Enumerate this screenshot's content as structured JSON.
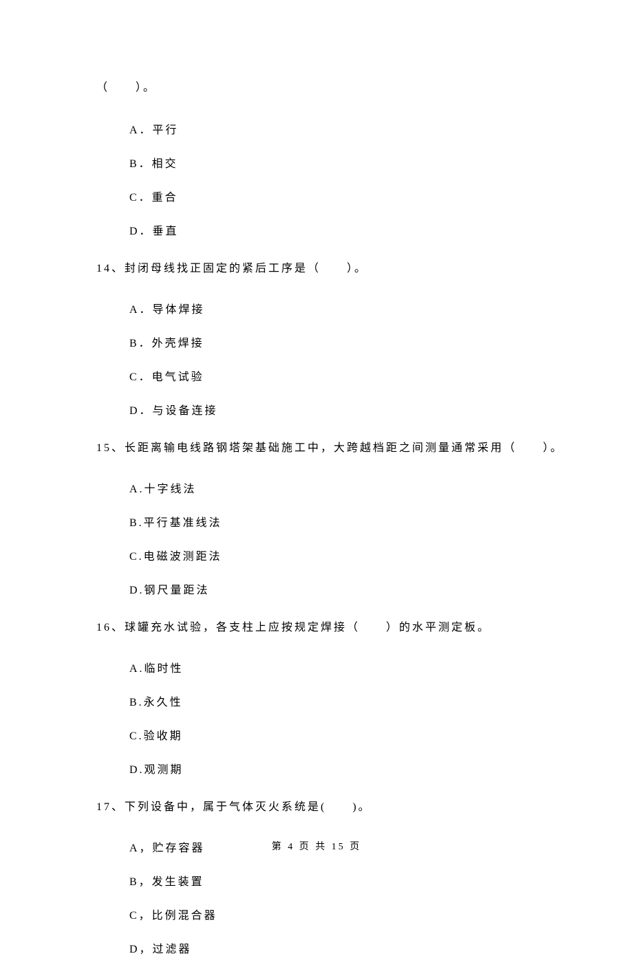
{
  "fragment": "（　　）。",
  "q13_options": {
    "a": "A．平行",
    "b": "B．相交",
    "c": "C．重合",
    "d": "D．垂直"
  },
  "q14": {
    "text": "14、封闭母线找正固定的紧后工序是（　　）。",
    "a": "A．导体焊接",
    "b": "B．外壳焊接",
    "c": "C．电气试验",
    "d": "D．与设备连接"
  },
  "q15": {
    "text": "15、长距离输电线路钢塔架基础施工中，大跨越档距之间测量通常采用（　　）。",
    "a": "A.十字线法",
    "b": "B.平行基准线法",
    "c": "C.电磁波测距法",
    "d": "D.钢尺量距法"
  },
  "q16": {
    "text": "16、球罐充水试验，各支柱上应按规定焊接（　　）的水平测定板。",
    "a": "A.临时性",
    "b": "B.永久性",
    "c": "C.验收期",
    "d": "D.观测期"
  },
  "q17": {
    "text": "17、下列设备中，属于气体灭火系统是(　　)。",
    "a": "A，贮存容器",
    "b": "B，发生装置",
    "c": "C，比例混合器",
    "d": "D，过滤器"
  },
  "footer": "第 4 页 共 15 页"
}
